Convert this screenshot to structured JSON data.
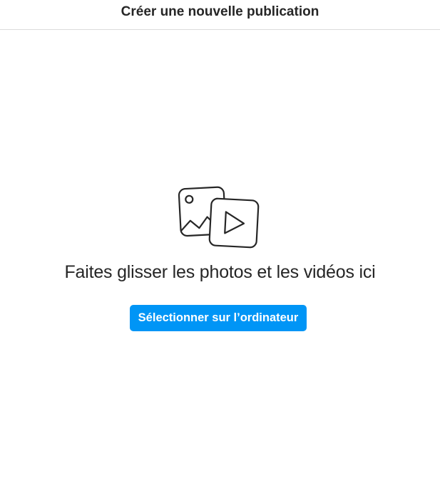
{
  "header": {
    "title": "Créer une nouvelle publication"
  },
  "dropzone": {
    "icon": "photo-video-icon",
    "message": "Faites glisser les photos et les vidéos ici",
    "select_button_label": "Sélectionner sur l’ordinateur"
  },
  "colors": {
    "accent": "#0095f6",
    "text": "#262626",
    "divider": "#dbdbdb"
  }
}
